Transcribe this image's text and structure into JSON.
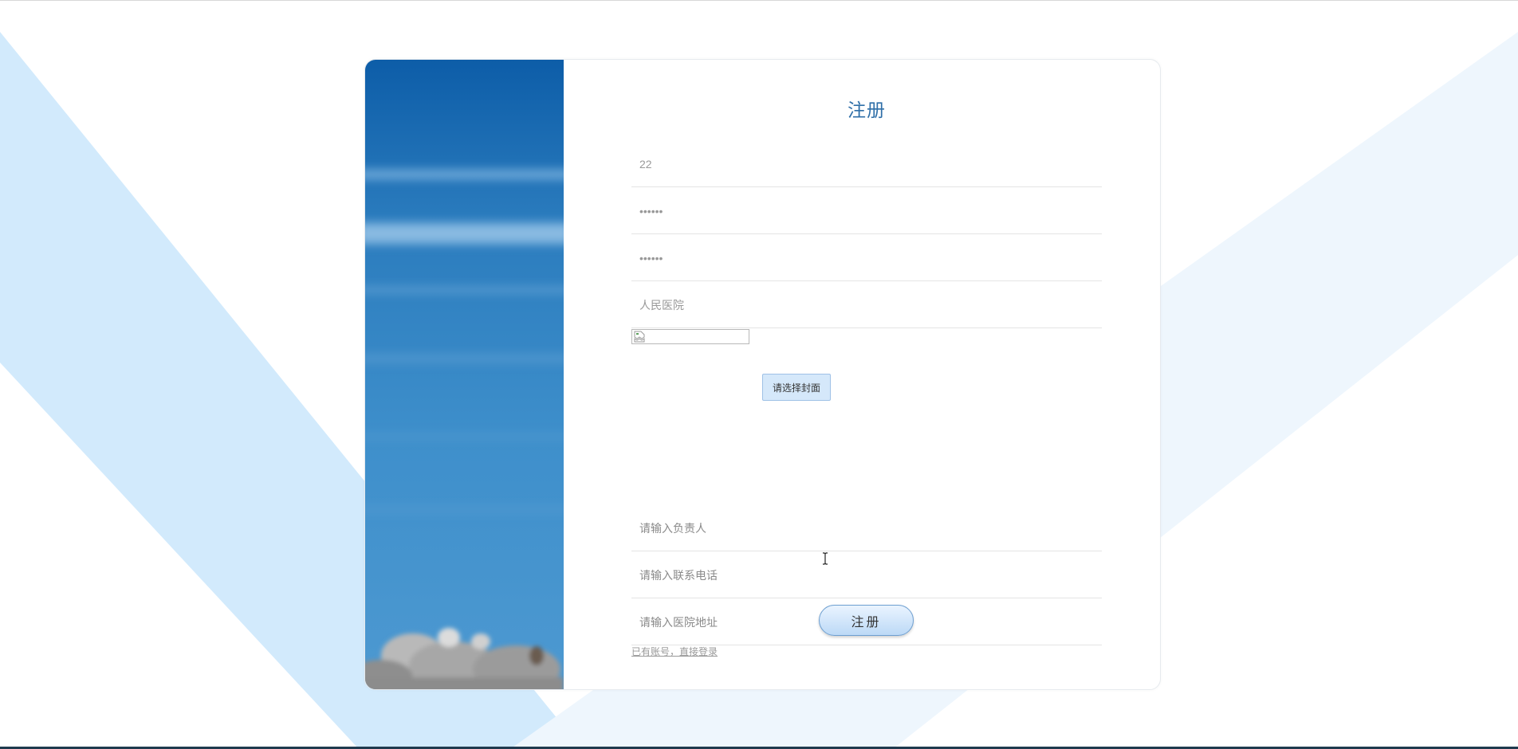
{
  "form": {
    "title": "注册",
    "account_value": "22",
    "password_value": "••••••",
    "confirm_password_value": "••••••",
    "hospital_name_value": "人民医院",
    "upload_button_label": "请选择封面",
    "contact_person_placeholder": "请输入负责人",
    "phone_placeholder": "请输入联系电话",
    "address_placeholder": "请输入医院地址",
    "submit_label": "注册",
    "login_link_text": "已有账号，直接登录"
  },
  "colors": {
    "title": "#2f6fa8",
    "background_shape": "#d2eafc",
    "submit_gradient_top": "#eaf4ff",
    "submit_gradient_bottom": "#bcd9f6"
  },
  "icons": {
    "broken_image": "broken-image-icon",
    "cursor": "text-cursor-icon"
  }
}
